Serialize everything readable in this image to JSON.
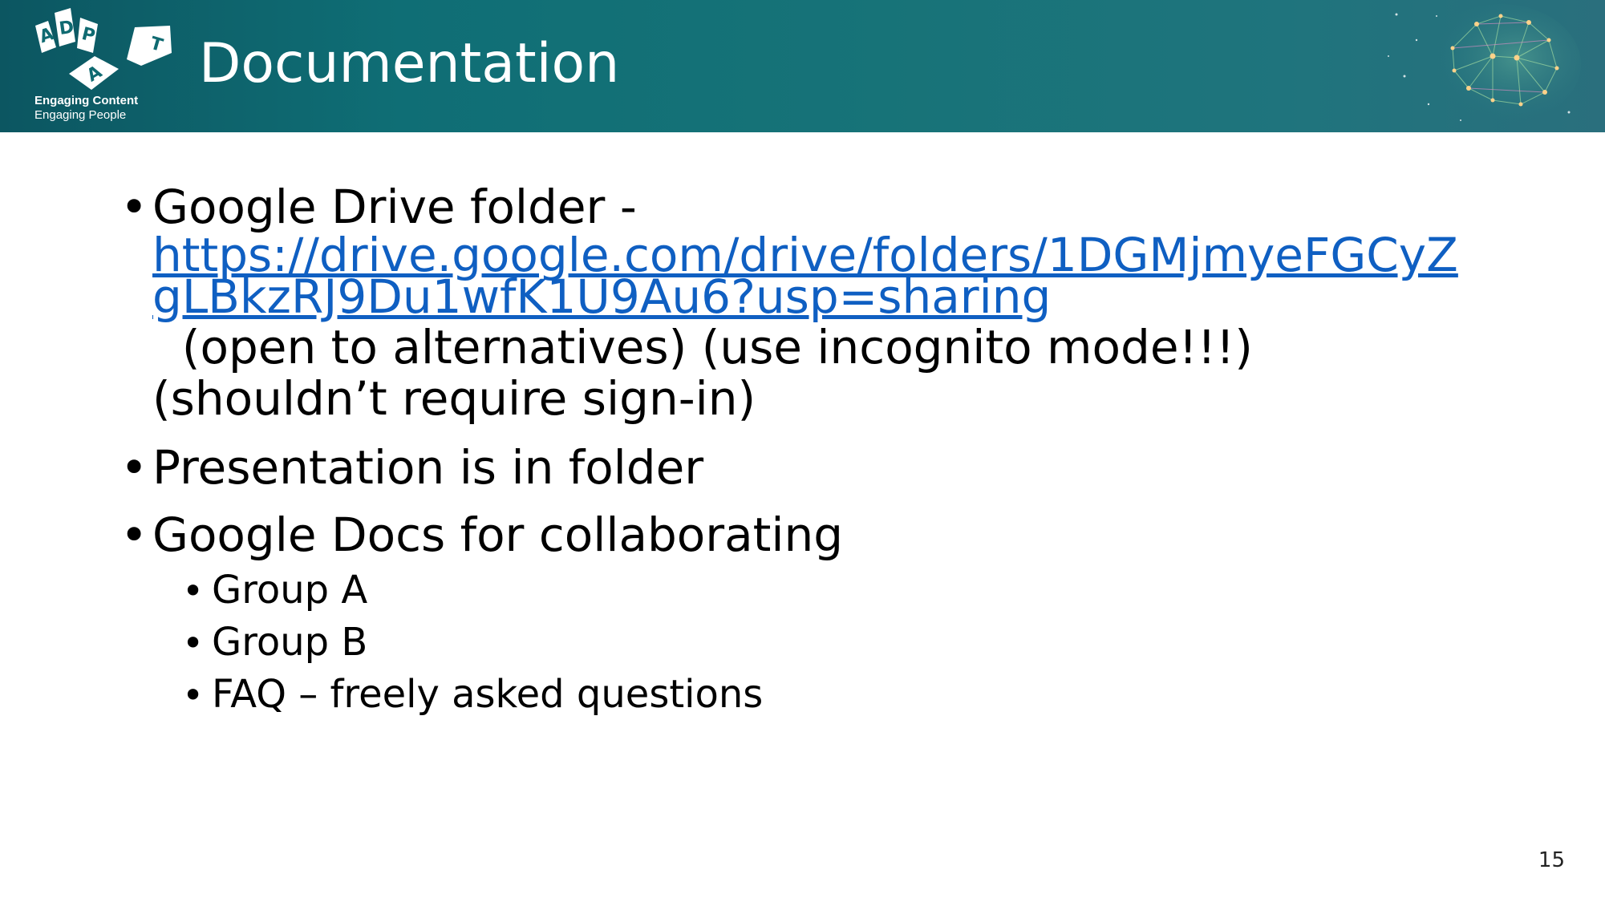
{
  "header": {
    "title": "Documentation",
    "logo": {
      "letters": [
        "A",
        "D",
        "P",
        "T",
        "A"
      ],
      "tagline_line1": "Engaging Content",
      "tagline_line2": "Engaging People"
    },
    "decoration": "brain-network-icon"
  },
  "bullets": {
    "item1": {
      "text": "Google Drive folder -",
      "link_line1": "https://drive.google.com/drive/folders/1DGMjmyeFGCyZ",
      "link_line2": "gLBkzRJ9Du1wfK1U9Au6?usp=sharing",
      "note_line1": "  (open to alternatives) (use incognito mode!!!)",
      "note_line2": "(shouldn’t require sign-in)"
    },
    "item2": {
      "text": "Presentation is in folder"
    },
    "item3": {
      "text": "Google Docs for collaborating",
      "subitems": [
        "Group A",
        "Group B",
        "FAQ – freely asked questions"
      ]
    },
    "bullet_glyph": "•"
  },
  "footer": {
    "page_number": "15"
  },
  "colors": {
    "header_start": "#0c5661",
    "header_end": "#2a6f7d",
    "link": "#0f5fc2",
    "text": "#000000"
  }
}
